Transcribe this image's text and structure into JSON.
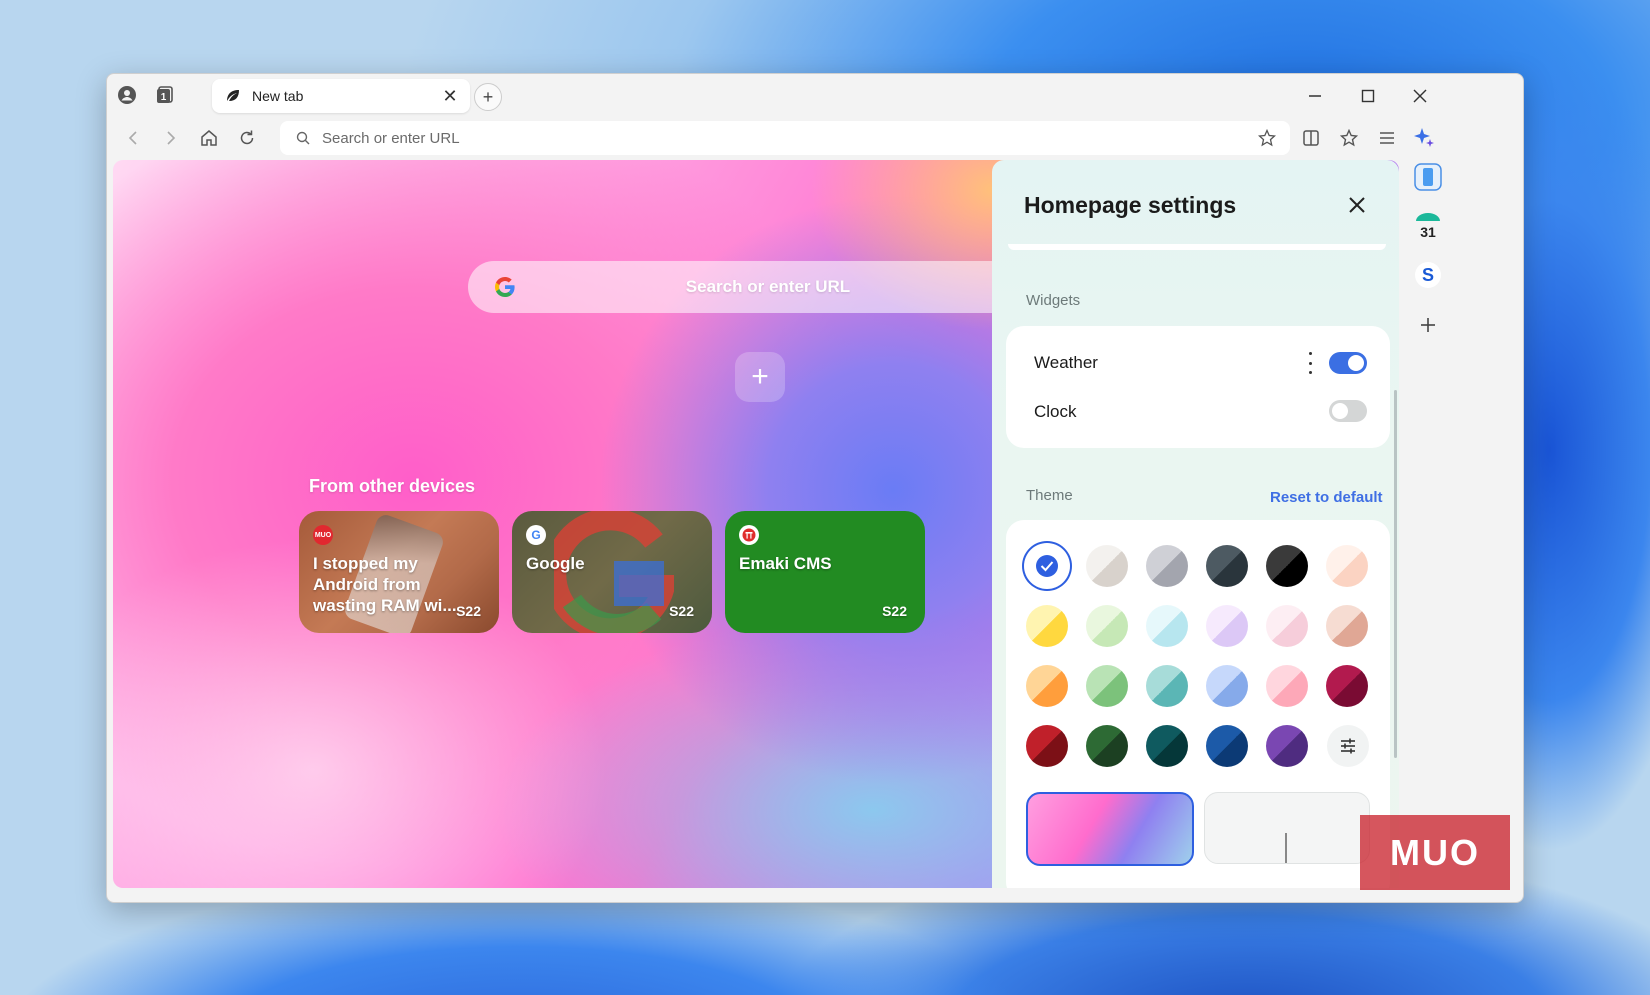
{
  "tab": {
    "title": "New tab",
    "workspace_count": "1"
  },
  "address_bar": {
    "placeholder": "Search or enter URL"
  },
  "home": {
    "search_placeholder": "Search or enter URL",
    "devices_heading": "From other devices",
    "cards": [
      {
        "title": "I stopped my Android from wasting RAM wi...",
        "device": "S22",
        "favicon": "MUO"
      },
      {
        "title": "Google",
        "device": "S22",
        "favicon": "G"
      },
      {
        "title": "Emaki CMS",
        "device": "S22",
        "favicon": "E"
      }
    ]
  },
  "panel": {
    "title": "Homepage settings",
    "widgets_label": "Widgets",
    "widgets": [
      {
        "label": "Weather",
        "enabled": true
      },
      {
        "label": "Clock",
        "enabled": false
      }
    ],
    "theme_label": "Theme",
    "reset_label": "Reset to default",
    "swatches": [
      [
        "#ffffff",
        "#2e5fe0"
      ],
      [
        "#f3f1ee",
        "#d8d2cc"
      ],
      [
        "#cfd0d6",
        "#a3a5ae"
      ],
      [
        "#4d5a62",
        "#2a353c"
      ],
      [
        "#3a3a3a",
        "#000000"
      ],
      [
        "#fff1ea",
        "#fbd3c2"
      ],
      [
        "#fff4b0",
        "#ffd83f"
      ],
      [
        "#e9f7de",
        "#c6e8b6"
      ],
      [
        "#e6f8fb",
        "#b7e6ef"
      ],
      [
        "#f6eafd",
        "#dcc8f6"
      ],
      [
        "#fdeef3",
        "#f6cdda"
      ],
      [
        "#f6dcd2",
        "#e0a795"
      ],
      [
        "#ffd596",
        "#ff9e3c"
      ],
      [
        "#b9e3b5",
        "#7cc27b"
      ],
      [
        "#a7dcd9",
        "#5bb6b5"
      ],
      [
        "#c6d8fb",
        "#86aaea"
      ],
      [
        "#ffd6de",
        "#fda8b8"
      ],
      [
        "#b21a4e",
        "#7a0b33"
      ],
      [
        "#c0202a",
        "#7c1016"
      ],
      [
        "#2d6a34",
        "#1c4022"
      ],
      [
        "#0f5a5f",
        "#053739"
      ],
      [
        "#1c5aa8",
        "#0c3a75"
      ],
      [
        "#7a47b2",
        "#4f2c80"
      ]
    ],
    "selected_swatch": 0
  },
  "side_rail": {
    "calendar_day": "31",
    "s_label": "S"
  },
  "watermark": "MUO"
}
